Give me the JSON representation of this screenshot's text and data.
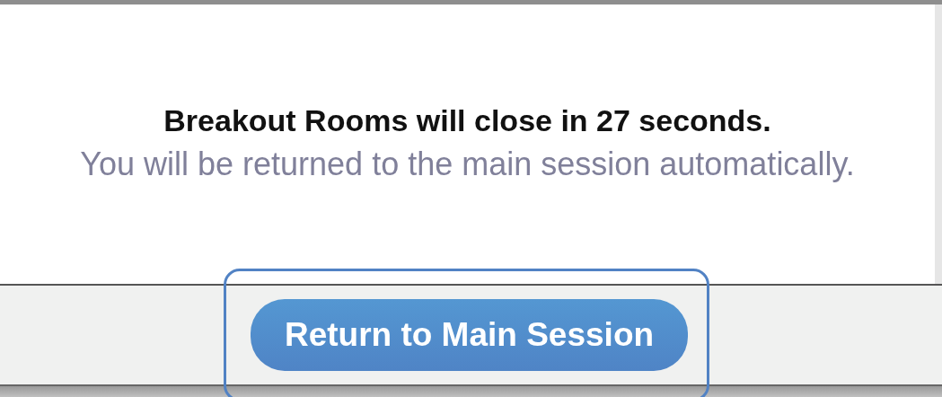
{
  "dialog": {
    "title": "Breakout Rooms will close in 27 seconds.",
    "message": "You will be returned to the main session automatically.",
    "button": {
      "label": "Return to Main Session",
      "highlighted": true
    }
  }
}
